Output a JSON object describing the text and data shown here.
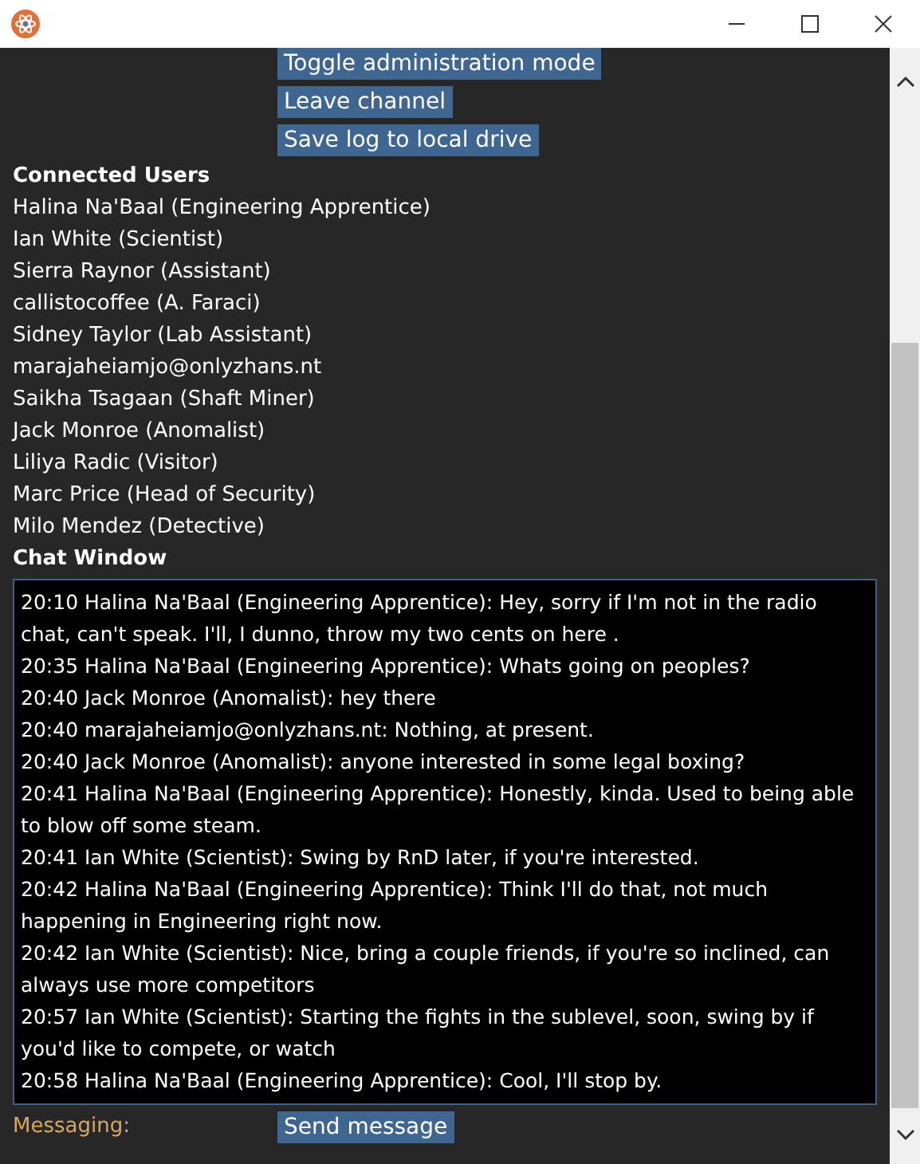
{
  "actions": [
    "Toggle administration mode",
    "Leave channel",
    "Save log to local drive"
  ],
  "connected_users": {
    "title": "Connected Users",
    "users": [
      "Halina Na'Baal (Engineering Apprentice)",
      "Ian White (Scientist)",
      "Sierra Raynor (Assistant)",
      "callistocoffee (A. Faraci)",
      "Sidney Taylor (Lab Assistant)",
      "marajaheiamjo@onlyzhans.nt",
      "Saikha Tsagaan (Shaft Miner)",
      "Jack Monroe (Anomalist)",
      "Liliya Radic (Visitor)",
      "Marc Price (Head of Security)",
      "Milo Mendez (Detective)"
    ]
  },
  "chat": {
    "title": "Chat Window",
    "messages": [
      "20:10 Halina Na'Baal (Engineering Apprentice): Hey, sorry if I'm not in the radio chat, can't speak. I'll, I dunno, throw my two cents on here .",
      "20:35 Halina Na'Baal (Engineering Apprentice): Whats going on peoples?",
      "20:40 Jack Monroe (Anomalist): hey there",
      "20:40 marajaheiamjo@onlyzhans.nt: Nothing, at present.",
      "20:40 Jack Monroe (Anomalist): anyone interested in some legal boxing?",
      "20:41 Halina Na'Baal (Engineering Apprentice): Honestly, kinda. Used to being able to blow off some steam.",
      "20:41 Ian White (Scientist): Swing by RnD later, if you're interested.",
      "20:42 Halina Na'Baal (Engineering Apprentice): Think I'll do that, not much happening in Engineering right now.",
      "20:42 Ian White (Scientist): Nice, bring a couple friends, if you're so inclined, can always use more competitors",
      "20:57 Ian White (Scientist): Starting the fights in the sublevel, soon, swing by if you'd like to compete, or watch",
      "20:58 Halina Na'Baal (Engineering Apprentice): Cool, I'll stop by."
    ]
  },
  "messaging": {
    "label": "Messaging:",
    "button": "Send message"
  }
}
